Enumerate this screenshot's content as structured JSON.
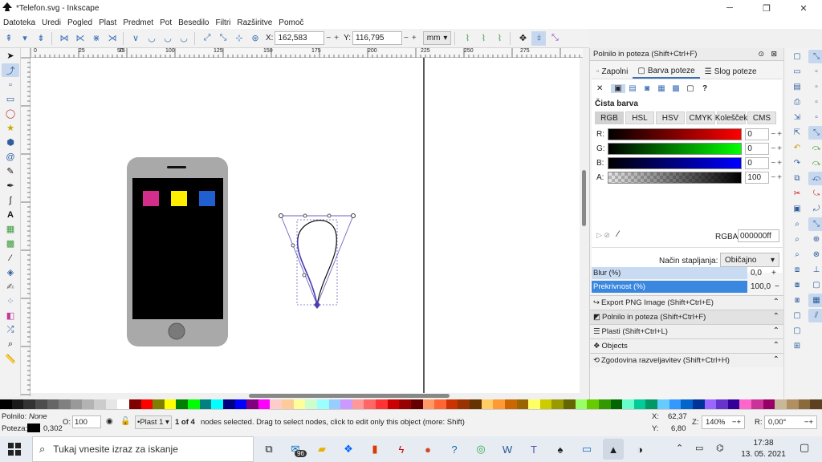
{
  "window": {
    "title": "*Telefon.svg - Inkscape",
    "minimize": "─",
    "restore": "❐",
    "close": "✕"
  },
  "menu": [
    "Datoteka",
    "Uredi",
    "Pogled",
    "Plast",
    "Predmet",
    "Pot",
    "Besedilo",
    "Filtri",
    "Razširitve",
    "Pomoč"
  ],
  "toolbar": {
    "x_label": "X:",
    "x_value": "162,583",
    "y_label": "Y:",
    "y_value": "116,795",
    "unit": "mm"
  },
  "ruler": {
    "ticks": [
      "0",
      "25",
      "50",
      "75",
      "100",
      "125",
      "150",
      "175",
      "200",
      "225",
      "250",
      "275"
    ]
  },
  "canvas": {
    "phone_body": "#a9a9a9",
    "phone_screen": "#000000",
    "app_colors": [
      "#d42e8c",
      "#ffee00",
      "#1f5fcf"
    ],
    "selection_color": "#6b62c4"
  },
  "dock": {
    "fill_stroke_title": "Polnilo in poteza  (Shift+Ctrl+F)",
    "tabs": [
      "Zapolni",
      "Barva poteze",
      "Slog poteze"
    ],
    "flat_color_label": "Čista barva",
    "mode_tabs": [
      "RGB",
      "HSL",
      "HSV",
      "CMYK",
      "Kolešček",
      "CMS"
    ],
    "channels": [
      {
        "label": "R:",
        "value": "0"
      },
      {
        "label": "G:",
        "value": "0"
      },
      {
        "label": "B:",
        "value": "0"
      },
      {
        "label": "A:",
        "value": "100"
      }
    ],
    "rgba_label": "RGBA:",
    "rgba_value": "000000ff",
    "blend_label": "Način stapljanja:",
    "blend_value": "Običajno",
    "blur_label": "Blur (%)",
    "blur_value": "0,0",
    "opacity_label": "Prekrivnost (%)",
    "opacity_value": "100,0",
    "panels": [
      "Export PNG Image (Shift+Ctrl+E)",
      "Polnilo in poteza  (Shift+Ctrl+F)",
      "Plasti  (Shift+Ctrl+L)",
      "Objects",
      "Zgodovina razveljavitev  (Shift+Ctrl+H)"
    ]
  },
  "status": {
    "fill_label": "Polnilo:",
    "fill_value": "None",
    "stroke_label": "Poteza:",
    "stroke_width": "0,302",
    "opacity_label": "O:",
    "opacity_value": "100",
    "layer": "•Plast 1",
    "message_bold": "1 of 4",
    "message": " nodes selected. Drag to select nodes, click to edit only this object (more: Shift)",
    "x_label": "X:",
    "x_value": "62,37",
    "y_label": "Y:",
    "y_value": "6,80",
    "zoom_label": "Z:",
    "zoom_value": "140%",
    "rot_label": "R:",
    "rot_value": "0,00°"
  },
  "taskbar": {
    "search_placeholder": "Tukaj vnesite izraz za iskanje",
    "mail_badge": "96",
    "time": "17:38",
    "date": "13. 05. 2021"
  },
  "palette": [
    "#000000",
    "#1a1a1a",
    "#333333",
    "#4d4d4d",
    "#666666",
    "#808080",
    "#999999",
    "#b3b3b3",
    "#cccccc",
    "#e6e6e6",
    "#ffffff",
    "#800000",
    "#ff0000",
    "#808000",
    "#ffff00",
    "#008000",
    "#00ff00",
    "#008080",
    "#00ffff",
    "#000080",
    "#0000ff",
    "#800080",
    "#ff00ff",
    "#ffcccc",
    "#ffcc99",
    "#ffff99",
    "#ccffcc",
    "#99ffff",
    "#99ccff",
    "#cc99ff",
    "#ff9999",
    "#ff6666",
    "#ff3333",
    "#cc0000",
    "#990000",
    "#660000",
    "#ff9966",
    "#ff6633",
    "#cc3300",
    "#993300",
    "#663300",
    "#ffcc66",
    "#ff9933",
    "#cc6600",
    "#996600",
    "#ffff66",
    "#cccc00",
    "#999900",
    "#666600",
    "#99ff66",
    "#66cc00",
    "#339900",
    "#006600",
    "#66ffcc",
    "#00cc99",
    "#009966",
    "#66ccff",
    "#3399ff",
    "#0066cc",
    "#003399",
    "#9966ff",
    "#6633cc",
    "#330099",
    "#ff66cc",
    "#cc3399",
    "#990066",
    "#c8b89a",
    "#b09060",
    "#8a6a3a",
    "#5c4020"
  ]
}
